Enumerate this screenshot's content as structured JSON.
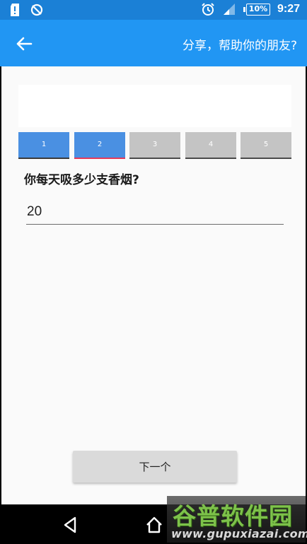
{
  "status_bar": {
    "battery": "10%",
    "time": "9:27"
  },
  "app_bar": {
    "title": "分享，帮助你的朋友?"
  },
  "steps": [
    {
      "label": "1",
      "state": "active"
    },
    {
      "label": "2",
      "state": "current"
    },
    {
      "label": "3",
      "state": "inactive"
    },
    {
      "label": "4",
      "state": "inactive"
    },
    {
      "label": "5",
      "state": "inactive"
    }
  ],
  "question": {
    "text": "你每天吸多少支香烟?",
    "answer": "20"
  },
  "next_button": {
    "label": "下一个"
  },
  "watermark": {
    "title": "谷普软件园",
    "url": "www.gupuxiazai.com"
  },
  "colors": {
    "status_bar": "#1b80d6",
    "app_bar": "#2196f3",
    "step_active": "#4a90e2",
    "step_inactive": "#c4c4c4",
    "step_current_underline": "#e53a5a"
  },
  "icons": {
    "back": "arrow-left-icon",
    "nav_back": "triangle-back-icon",
    "nav_home": "home-icon"
  }
}
